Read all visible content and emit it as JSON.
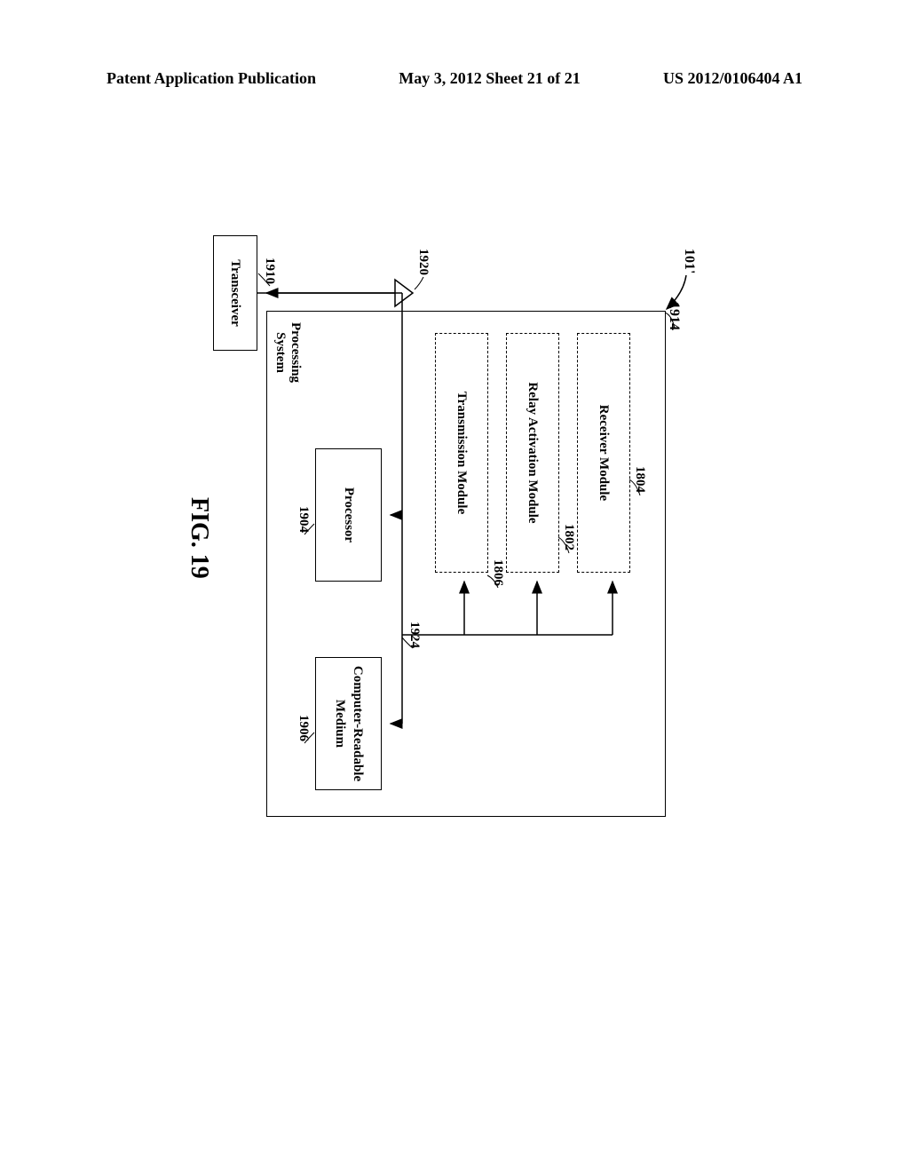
{
  "header": {
    "left": "Patent Application Publication",
    "center": "May 3, 2012  Sheet 21 of 21",
    "right": "US 2012/0106404 A1"
  },
  "labels": {
    "apparatus_ref": "101'",
    "processing_system_ref": "1914",
    "receiver_module_ref": "1804",
    "relay_activation_ref": "1802",
    "transmission_module_ref": "1806",
    "bus_ref": "1924",
    "processor_ref": "1904",
    "medium_ref": "1906",
    "transceiver_ref": "1910",
    "antenna_ref": "1920"
  },
  "boxes": {
    "receiver_module": "Receiver Module",
    "relay_activation": "Relay Activation Module",
    "transmission_module": "Transmission Module",
    "processor": "Processor",
    "medium": "Computer-Readable\nMedium",
    "transceiver": "Transceiver",
    "processing_system": "Processing\nSystem"
  },
  "figure_label": "FIG. 19"
}
